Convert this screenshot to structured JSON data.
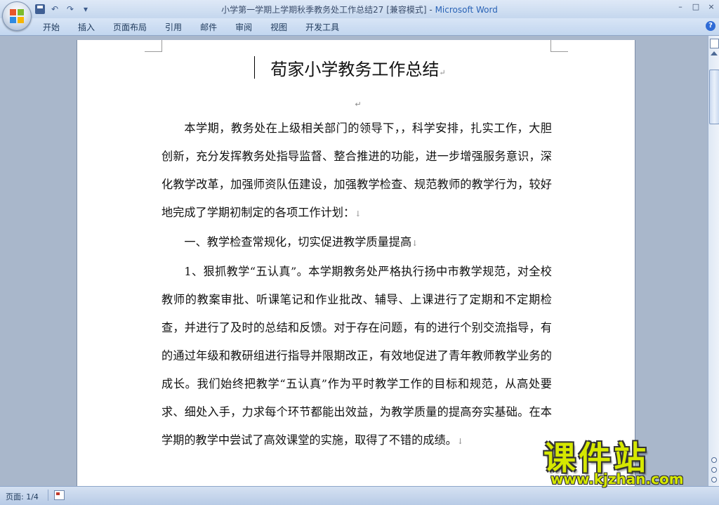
{
  "window": {
    "title": "小学第一学期上学期秋季教务处工作总结27 [兼容模式] - ",
    "app_name": "Microsoft Word",
    "controls": [
      "–",
      "□",
      "×"
    ]
  },
  "quick_access": {
    "save_icon": "save-icon",
    "undo": "↶",
    "redo": "↷",
    "customize": "▾"
  },
  "ribbon": {
    "tabs": [
      "开始",
      "插入",
      "页面布局",
      "引用",
      "邮件",
      "审阅",
      "视图",
      "开发工具"
    ],
    "help": "?"
  },
  "document": {
    "title": "荀家小学教务工作总结",
    "paragraph_mark": "↵",
    "line_break_mark": "↓",
    "paragraphs": [
      "本学期，教务处在上级相关部门的领导下，，科学安排，扎实工作，大胆创新，充分发挥教务处指导监督、整合推进的功能，进一步增强服务意识，深化教学改革，加强师资队伍建设，加强教学检查、规范教师的教学行为，较好地完成了学期初制定的各项工作计划：",
      "一、教学检查常规化，切实促进教学质量提高",
      "1、狠抓教学“五认真”。本学期教务处严格执行扬中市教学规范，对全校教师的教案审批、听课笔记和作业批改、辅导、上课进行了定期和不定期检查，并进行了及时的总结和反馈。对于存在问题，有的进行个别交流指导，有的通过年级和教研组进行指导并限期改正，有效地促进了青年教师教学业务的成长。我们始终把教学“五认真”作为平时教学工作的目标和规范，从高处要求、细处入手，力求每个环节都能出效益，为教学质量的提高夯实基础。在本学期的教学中尝试了高效课堂的实施，取得了不错的成绩。"
    ]
  },
  "statusbar": {
    "page": "页面: 1/4"
  },
  "watermark": {
    "title": "课件站",
    "url": "www.kjzhan.com"
  }
}
